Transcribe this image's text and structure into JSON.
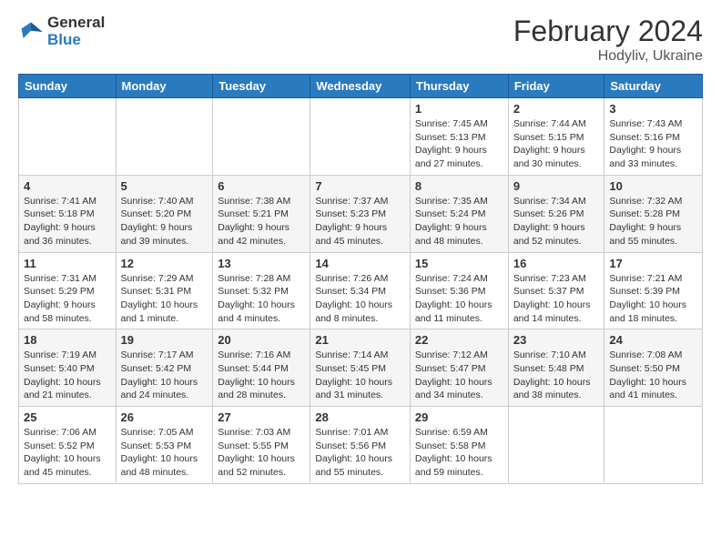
{
  "header": {
    "logo_line1": "General",
    "logo_line2": "Blue",
    "main_title": "February 2024",
    "subtitle": "Hodyliv, Ukraine"
  },
  "weekdays": [
    "Sunday",
    "Monday",
    "Tuesday",
    "Wednesday",
    "Thursday",
    "Friday",
    "Saturday"
  ],
  "weeks": [
    [
      {
        "day": "",
        "sunrise": "",
        "sunset": "",
        "daylight": ""
      },
      {
        "day": "",
        "sunrise": "",
        "sunset": "",
        "daylight": ""
      },
      {
        "day": "",
        "sunrise": "",
        "sunset": "",
        "daylight": ""
      },
      {
        "day": "",
        "sunrise": "",
        "sunset": "",
        "daylight": ""
      },
      {
        "day": "1",
        "sunrise": "7:45 AM",
        "sunset": "5:13 PM",
        "daylight": "9 hours and 27 minutes."
      },
      {
        "day": "2",
        "sunrise": "7:44 AM",
        "sunset": "5:15 PM",
        "daylight": "9 hours and 30 minutes."
      },
      {
        "day": "3",
        "sunrise": "7:43 AM",
        "sunset": "5:16 PM",
        "daylight": "9 hours and 33 minutes."
      }
    ],
    [
      {
        "day": "4",
        "sunrise": "7:41 AM",
        "sunset": "5:18 PM",
        "daylight": "9 hours and 36 minutes."
      },
      {
        "day": "5",
        "sunrise": "7:40 AM",
        "sunset": "5:20 PM",
        "daylight": "9 hours and 39 minutes."
      },
      {
        "day": "6",
        "sunrise": "7:38 AM",
        "sunset": "5:21 PM",
        "daylight": "9 hours and 42 minutes."
      },
      {
        "day": "7",
        "sunrise": "7:37 AM",
        "sunset": "5:23 PM",
        "daylight": "9 hours and 45 minutes."
      },
      {
        "day": "8",
        "sunrise": "7:35 AM",
        "sunset": "5:24 PM",
        "daylight": "9 hours and 48 minutes."
      },
      {
        "day": "9",
        "sunrise": "7:34 AM",
        "sunset": "5:26 PM",
        "daylight": "9 hours and 52 minutes."
      },
      {
        "day": "10",
        "sunrise": "7:32 AM",
        "sunset": "5:28 PM",
        "daylight": "9 hours and 55 minutes."
      }
    ],
    [
      {
        "day": "11",
        "sunrise": "7:31 AM",
        "sunset": "5:29 PM",
        "daylight": "9 hours and 58 minutes."
      },
      {
        "day": "12",
        "sunrise": "7:29 AM",
        "sunset": "5:31 PM",
        "daylight": "10 hours and 1 minute."
      },
      {
        "day": "13",
        "sunrise": "7:28 AM",
        "sunset": "5:32 PM",
        "daylight": "10 hours and 4 minutes."
      },
      {
        "day": "14",
        "sunrise": "7:26 AM",
        "sunset": "5:34 PM",
        "daylight": "10 hours and 8 minutes."
      },
      {
        "day": "15",
        "sunrise": "7:24 AM",
        "sunset": "5:36 PM",
        "daylight": "10 hours and 11 minutes."
      },
      {
        "day": "16",
        "sunrise": "7:23 AM",
        "sunset": "5:37 PM",
        "daylight": "10 hours and 14 minutes."
      },
      {
        "day": "17",
        "sunrise": "7:21 AM",
        "sunset": "5:39 PM",
        "daylight": "10 hours and 18 minutes."
      }
    ],
    [
      {
        "day": "18",
        "sunrise": "7:19 AM",
        "sunset": "5:40 PM",
        "daylight": "10 hours and 21 minutes."
      },
      {
        "day": "19",
        "sunrise": "7:17 AM",
        "sunset": "5:42 PM",
        "daylight": "10 hours and 24 minutes."
      },
      {
        "day": "20",
        "sunrise": "7:16 AM",
        "sunset": "5:44 PM",
        "daylight": "10 hours and 28 minutes."
      },
      {
        "day": "21",
        "sunrise": "7:14 AM",
        "sunset": "5:45 PM",
        "daylight": "10 hours and 31 minutes."
      },
      {
        "day": "22",
        "sunrise": "7:12 AM",
        "sunset": "5:47 PM",
        "daylight": "10 hours and 34 minutes."
      },
      {
        "day": "23",
        "sunrise": "7:10 AM",
        "sunset": "5:48 PM",
        "daylight": "10 hours and 38 minutes."
      },
      {
        "day": "24",
        "sunrise": "7:08 AM",
        "sunset": "5:50 PM",
        "daylight": "10 hours and 41 minutes."
      }
    ],
    [
      {
        "day": "25",
        "sunrise": "7:06 AM",
        "sunset": "5:52 PM",
        "daylight": "10 hours and 45 minutes."
      },
      {
        "day": "26",
        "sunrise": "7:05 AM",
        "sunset": "5:53 PM",
        "daylight": "10 hours and 48 minutes."
      },
      {
        "day": "27",
        "sunrise": "7:03 AM",
        "sunset": "5:55 PM",
        "daylight": "10 hours and 52 minutes."
      },
      {
        "day": "28",
        "sunrise": "7:01 AM",
        "sunset": "5:56 PM",
        "daylight": "10 hours and 55 minutes."
      },
      {
        "day": "29",
        "sunrise": "6:59 AM",
        "sunset": "5:58 PM",
        "daylight": "10 hours and 59 minutes."
      },
      {
        "day": "",
        "sunrise": "",
        "sunset": "",
        "daylight": ""
      },
      {
        "day": "",
        "sunrise": "",
        "sunset": "",
        "daylight": ""
      }
    ]
  ]
}
